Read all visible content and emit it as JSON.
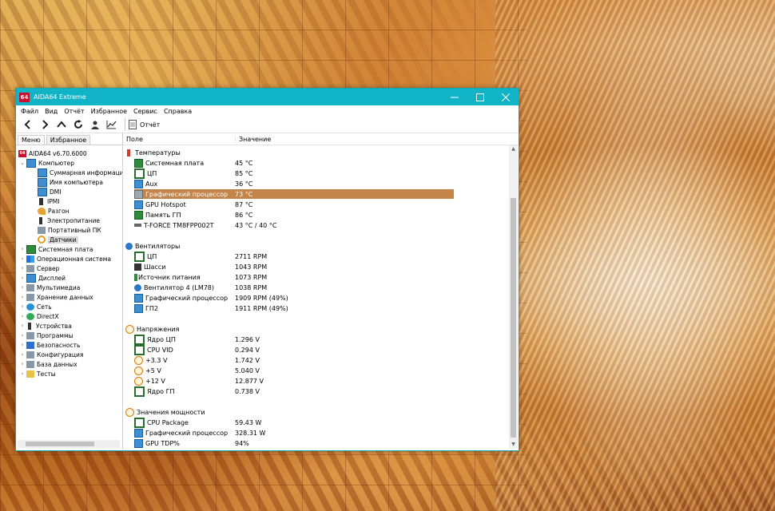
{
  "window": {
    "title": "AIDA64 Extreme",
    "app_badge": "64"
  },
  "menu": [
    "Файл",
    "Вид",
    "Отчёт",
    "Избранное",
    "Сервис",
    "Справка"
  ],
  "toolbar": {
    "report_label": "Отчёт"
  },
  "left_tabs": [
    "Меню",
    "Избранное"
  ],
  "tree": [
    {
      "label": "AIDA64 v6.70.6000",
      "icon": "aida64-logo-icon"
    },
    {
      "label": "Компьютер",
      "icon": "computer-icon"
    },
    {
      "label": "Суммарная информация",
      "icon": "summary-icon"
    },
    {
      "label": "Имя компьютера",
      "icon": "computer-name-icon"
    },
    {
      "label": "DMI",
      "icon": "dmi-icon"
    },
    {
      "label": "IPMI",
      "icon": "ipmi-icon"
    },
    {
      "label": "Разгон",
      "icon": "overclock-icon"
    },
    {
      "label": "Электропитание",
      "icon": "power-icon"
    },
    {
      "label": "Портативный ПК",
      "icon": "laptop-icon"
    },
    {
      "label": "Датчики",
      "icon": "sensor-icon"
    },
    {
      "label": "Системная плата",
      "icon": "motherboard-icon"
    },
    {
      "label": "Операционная система",
      "icon": "os-icon"
    },
    {
      "label": "Сервер",
      "icon": "server-icon"
    },
    {
      "label": "Дисплей",
      "icon": "display-icon"
    },
    {
      "label": "Мультимедиа",
      "icon": "multimedia-icon"
    },
    {
      "label": "Хранение данных",
      "icon": "storage-icon"
    },
    {
      "label": "Сеть",
      "icon": "network-icon"
    },
    {
      "label": "DirectX",
      "icon": "directx-icon"
    },
    {
      "label": "Устройства",
      "icon": "devices-icon"
    },
    {
      "label": "Программы",
      "icon": "programs-icon"
    },
    {
      "label": "Безопасность",
      "icon": "security-icon"
    },
    {
      "label": "Конфигурация",
      "icon": "config-icon"
    },
    {
      "label": "База данных",
      "icon": "database-icon"
    },
    {
      "label": "Тесты",
      "icon": "tests-icon"
    }
  ],
  "columns": {
    "field": "Поле",
    "value": "Значение"
  },
  "groups": {
    "temps": "Температуры",
    "fans": "Вентиляторы",
    "volts": "Напряжения",
    "power": "Значения мощности"
  },
  "temps": [
    {
      "field": "Системная плата",
      "value": "45 °C"
    },
    {
      "field": "ЦП",
      "value": "85 °C"
    },
    {
      "field": "Aux",
      "value": "36 °C"
    },
    {
      "field": "Графический процессор",
      "value": "73 °C"
    },
    {
      "field": "GPU Hotspot",
      "value": "87 °C"
    },
    {
      "field": "Память ГП",
      "value": "86 °C"
    },
    {
      "field": "T-FORCE TM8FPP002T",
      "value": "43 °C / 40 °C"
    }
  ],
  "fans": [
    {
      "field": "ЦП",
      "value": "2711 RPM"
    },
    {
      "field": "Шасси",
      "value": "1043 RPM"
    },
    {
      "field": "Источник питания",
      "value": "1073 RPM"
    },
    {
      "field": "Вентилятор 4 (LM78)",
      "value": "1038 RPM"
    },
    {
      "field": "Графический процессор",
      "value": "1909 RPM  (49%)"
    },
    {
      "field": "ГП2",
      "value": "1911 RPM  (49%)"
    }
  ],
  "volts": [
    {
      "field": "Ядро ЦП",
      "value": "1.296 V"
    },
    {
      "field": "CPU VID",
      "value": "0.294 V"
    },
    {
      "field": "+3.3 V",
      "value": "1.742 V"
    },
    {
      "field": "+5 V",
      "value": "5.040 V"
    },
    {
      "field": "+12 V",
      "value": "12.877 V"
    },
    {
      "field": "Ядро ГП",
      "value": "0.738 V"
    }
  ],
  "power": [
    {
      "field": "CPU Package",
      "value": "59.43 W"
    },
    {
      "field": "Графический процессор",
      "value": "328.31 W"
    },
    {
      "field": "GPU TDP%",
      "value": "94%"
    }
  ]
}
